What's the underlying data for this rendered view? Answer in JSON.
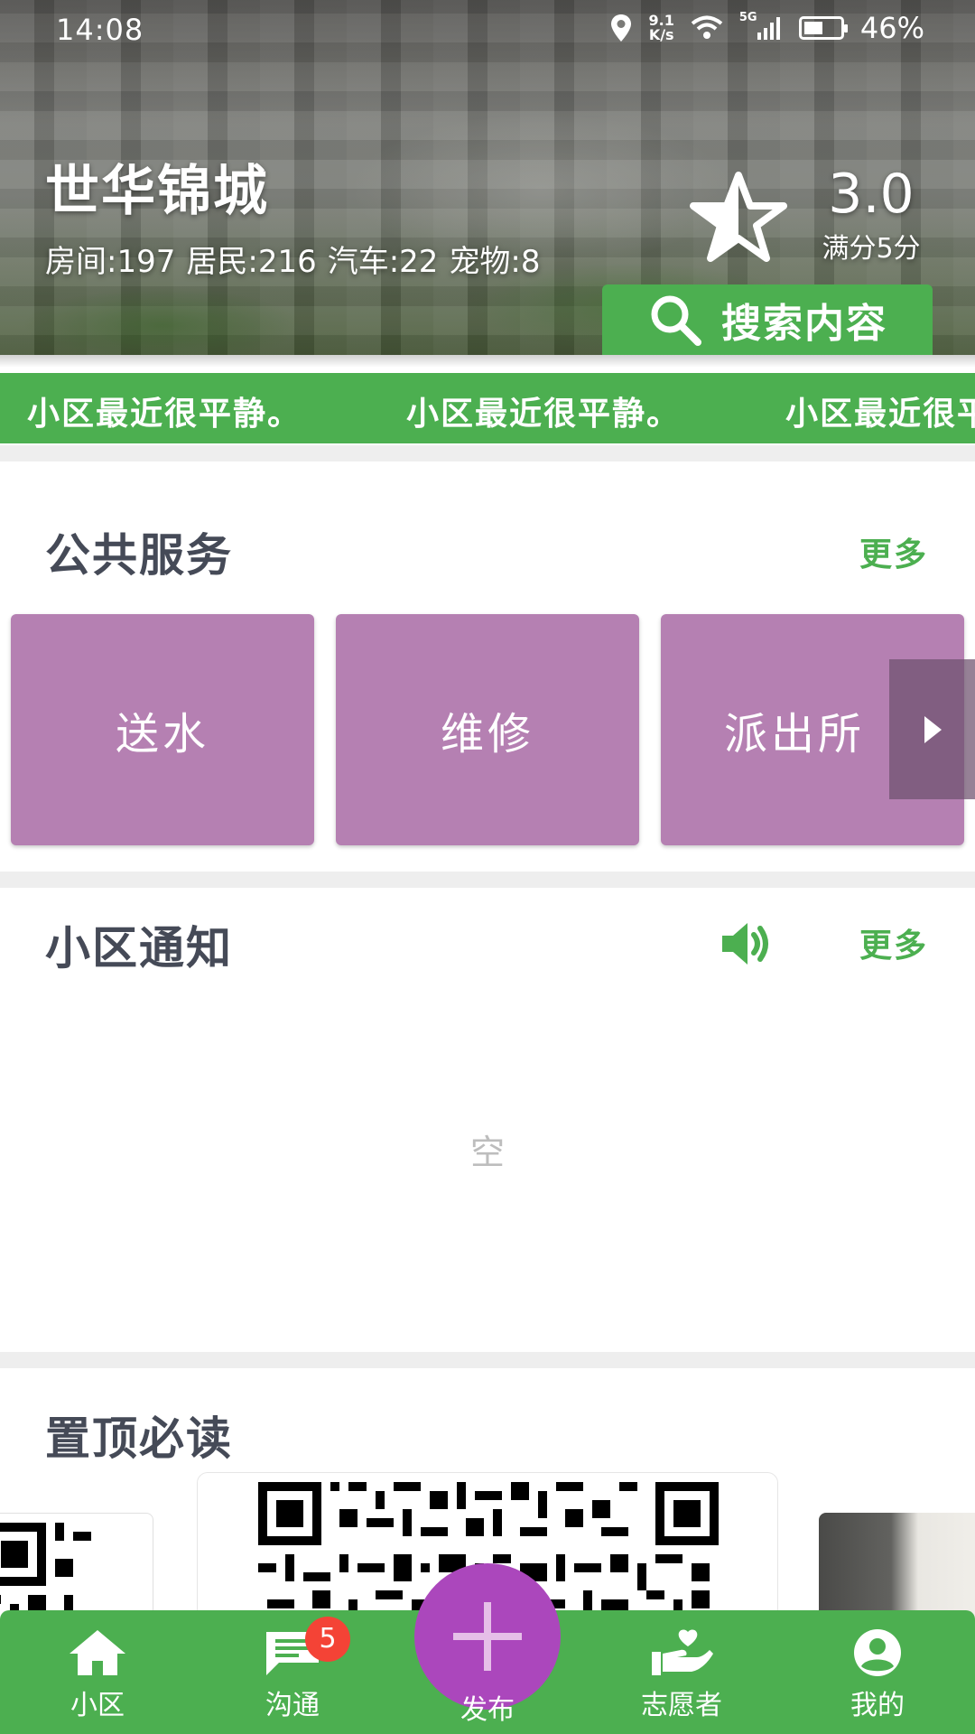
{
  "status_bar": {
    "time": "14:08",
    "speed_value": "9.1",
    "speed_unit": "K/s",
    "network": "5G",
    "battery": "46%"
  },
  "header": {
    "community_name": "世华锦城",
    "stats": [
      "房间:197",
      "居民:216",
      "汽车:22",
      "宠物:8"
    ],
    "rating_value": "3.0",
    "rating_caption": "满分5分",
    "search_label": "搜索内容",
    "icons": {
      "rating": "star-icon",
      "search": "search-icon"
    }
  },
  "marquee": {
    "text": "小区最近很平静。"
  },
  "public_services": {
    "title": "公共服务",
    "more": "更多",
    "items": [
      "送水",
      "维修",
      "派出所"
    ],
    "scroll_icon": "chevron-right-icon"
  },
  "notices": {
    "title": "小区通知",
    "more": "更多",
    "empty": "空",
    "icon": "speaker-icon"
  },
  "pinned": {
    "title": "置顶必读"
  },
  "bottom_nav": {
    "items": [
      {
        "label": "小区",
        "icon": "home-icon"
      },
      {
        "label": "沟通",
        "icon": "chat-icon",
        "badge": "5"
      },
      {
        "label": "发布",
        "icon": "plus-icon"
      },
      {
        "label": "志愿者",
        "icon": "volunteer-heart-hand-icon"
      },
      {
        "label": "我的",
        "icon": "account-circle-icon"
      }
    ]
  },
  "colors": {
    "brand_green": "#4caf50",
    "card_purple": "#b580b2",
    "publish_purple": "#ab47bc",
    "badge_red": "#f44336",
    "title_text": "#454a57"
  }
}
